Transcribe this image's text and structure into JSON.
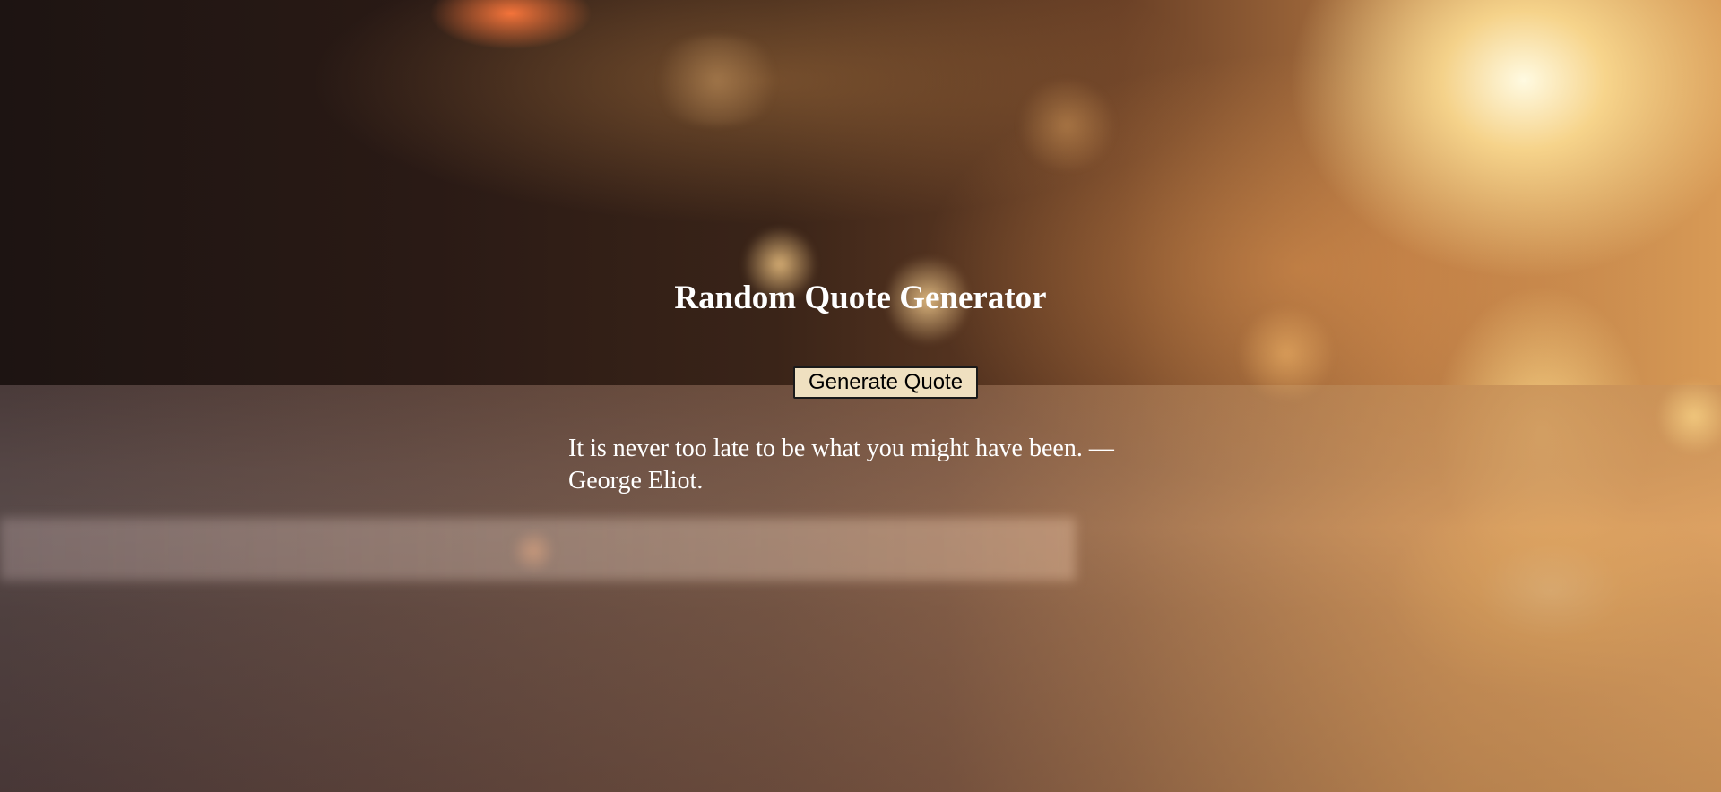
{
  "page": {
    "title": "Random Quote Generator",
    "button_label": "Generate Quote",
    "quote_text": "It is never too late to be what you might have been. — George Eliot."
  },
  "colors": {
    "title_text": "#ffffff",
    "quote_text": "#ffffff",
    "button_background": "#efe0c0",
    "button_border": "#1a1a1a"
  },
  "background": {
    "description_icon": "blurred-sunset-street-photo"
  }
}
